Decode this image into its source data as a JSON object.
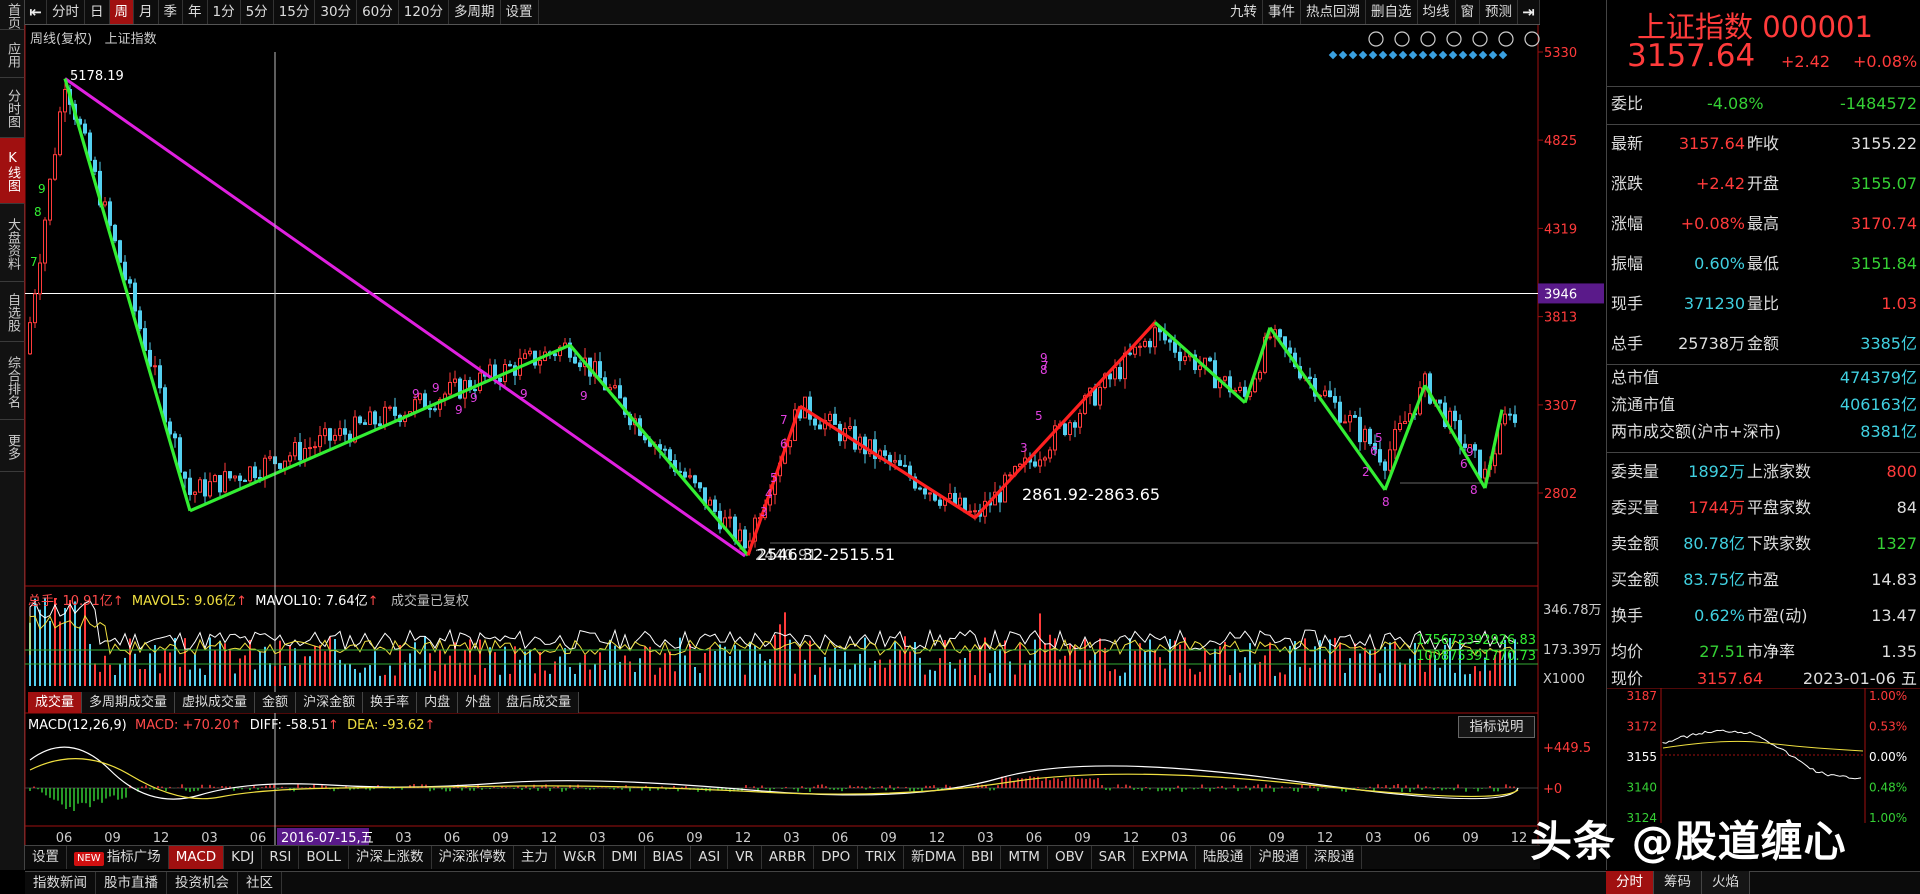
{
  "nav": [
    "首页",
    "应用",
    "分时图",
    "K线图",
    "大盘资料",
    "自选股",
    "综合排名",
    "更多"
  ],
  "toolbar": {
    "periods": [
      "分时",
      "日",
      "周",
      "月",
      "季",
      "年",
      "1分",
      "5分",
      "15分",
      "30分",
      "60分",
      "120分",
      "多周期",
      "设置"
    ],
    "active": "周",
    "tools": [
      "九转",
      "事件",
      "热点回溯",
      "删自选",
      "均线",
      "窗",
      "预测"
    ]
  },
  "chart": {
    "info_type": "周线(复权)",
    "info_name": "上证指数",
    "yaxis": [
      "5330",
      "4825",
      "4319",
      "3946",
      "3813",
      "3307",
      "2802"
    ],
    "high_label": "5178.19",
    "low_label_a": "2440.91",
    "low_label": "2546.32-2515.51",
    "mid_label": "2861.92-2863.65",
    "xaxis": [
      "06",
      "09",
      "12",
      "03",
      "06",
      "09",
      "12",
      "03",
      "06",
      "09",
      "12",
      "03",
      "06",
      "09",
      "12",
      "03",
      "06",
      "09",
      "12",
      "03",
      "06",
      "09",
      "12",
      "03",
      "06",
      "09",
      "12",
      "03",
      "06",
      "09",
      "12"
    ],
    "cursor_date": "2016-07-15,五",
    "td_numbers": [
      "9",
      "8",
      "7",
      "9",
      "9",
      "9",
      "9",
      "9",
      "9",
      "6",
      "5",
      "4",
      "3",
      "7",
      "9",
      "8",
      "5",
      "3",
      "5",
      "6",
      "2",
      "8",
      "8",
      "6",
      "9",
      "7"
    ]
  },
  "volume": {
    "label_total": "总手: 10.91亿",
    "label_ma5": "MAVOL5: 9.06亿",
    "label_ma10": "MAVOL10: 7.64亿",
    "label_note": "成交量已复权",
    "y_top": "346.78万",
    "y_mid": "173.39万",
    "y_unit": "X1000",
    "right_val1": "175672392926.83",
    "right_val2": "100875391770.73"
  },
  "voltabs": [
    "成交量",
    "多周期成交量",
    "虚拟成交量",
    "金额",
    "沪深金额",
    "换手率",
    "内盘",
    "外盘",
    "盘后成交量"
  ],
  "macd": {
    "label_name": "MACD(12,26,9)",
    "label_macd": "MACD: +70.20",
    "label_diff": "DIFF: -58.51",
    "label_dea": "DEA: -93.62",
    "y_top": "+449.5",
    "y_zero": "+0",
    "button": "指标说明"
  },
  "bottom": {
    "settings": "设置",
    "new_badge": "NEW",
    "items": [
      "指标广场",
      "MACD",
      "KDJ",
      "RSI",
      "BOLL",
      "沪深上涨数",
      "沪深涨停数",
      "主力",
      "W&R",
      "DMI",
      "BIAS",
      "ASI",
      "VR",
      "ARBR",
      "DPO",
      "TRIX",
      "新DMA",
      "BBI",
      "MTM",
      "OBV",
      "SAR",
      "EXPMA",
      "陆股通",
      "沪股通",
      "深股通"
    ],
    "active": "MACD"
  },
  "footer": [
    "指数新闻",
    "股市直播",
    "投资机会",
    "社区"
  ],
  "quote": {
    "title": "上证指数 000001",
    "price": "3157.64",
    "change": "+2.42",
    "pct": "+0.08%",
    "weibi_label": "委比",
    "weibi_pct": "-4.08%",
    "weibi_val": "-1484572",
    "rows": [
      {
        "l1": "最新",
        "v1": "3157.64",
        "l2": "昨收",
        "v2": "3155.22"
      },
      {
        "l1": "涨跌",
        "v1": "+2.42",
        "l2": "开盘",
        "v2": "3155.07"
      },
      {
        "l1": "涨幅",
        "v1": "+0.08%",
        "l2": "最高",
        "v2": "3170.74"
      },
      {
        "l1": "振幅",
        "v1": "0.60%",
        "l2": "最低",
        "v2": "3151.84"
      },
      {
        "l1": "现手",
        "v1": "371230",
        "l2": "量比",
        "v2": "1.03"
      },
      {
        "l1": "总手",
        "v1": "25738万",
        "l2": "金额",
        "v2": "3385亿"
      }
    ],
    "mv_rows": [
      {
        "l": "总市值",
        "v": "474379亿"
      },
      {
        "l": "流通市值",
        "v": "406163亿"
      },
      {
        "l": "两市成交额(沪市+深市)",
        "v": "8381亿"
      }
    ],
    "rows2": [
      {
        "l1": "委卖量",
        "v1": "1892万",
        "l2": "上涨家数",
        "v2": "800"
      },
      {
        "l1": "委买量",
        "v1": "1744万",
        "l2": "平盘家数",
        "v2": "84"
      },
      {
        "l1": "卖金额",
        "v1": "80.78亿",
        "l2": "下跌家数",
        "v2": "1327"
      },
      {
        "l1": "买金额",
        "v1": "83.75亿",
        "l2": "市盈",
        "v2": "14.83"
      },
      {
        "l1": "换手",
        "v1": "0.62%",
        "l2": "市盈(动)",
        "v2": "13.47"
      },
      {
        "l1": "均价",
        "v1": "27.51",
        "l2": "市净率",
        "v2": "1.35"
      }
    ],
    "xianjia_label": "现价",
    "xianjia_val": "3157.64",
    "date": "2023-01-06 五",
    "mini_left": [
      "3187",
      "3172",
      "3155",
      "3140",
      "3124"
    ],
    "mini_right": [
      "1.00%",
      "0.53%",
      "0.00%",
      "0.48%",
      "1.00%"
    ]
  },
  "rtabs": [
    "分时",
    "筹码",
    "火焰"
  ],
  "watermark": "头条 @股道缠心",
  "colors": {
    "up": "#ff3b3b",
    "down": "#54d0f0",
    "accent": "#a01010",
    "zigzag_green": "#33ee33",
    "zigzag_red": "#ff2020",
    "trend_magenta": "#e020e0"
  }
}
